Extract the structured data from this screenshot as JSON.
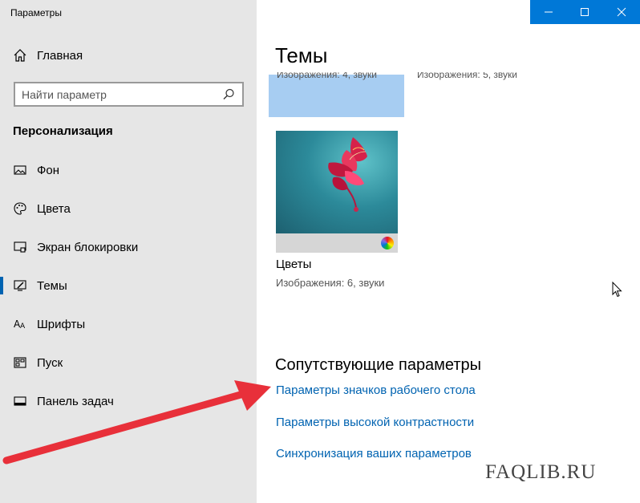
{
  "window": {
    "title": "Параметры"
  },
  "sidebar": {
    "home_label": "Главная",
    "search_placeholder": "Найти параметр",
    "section_heading": "Персонализация",
    "items": [
      {
        "label": "Фон",
        "icon": "image-icon",
        "active": false
      },
      {
        "label": "Цвета",
        "icon": "palette-icon",
        "active": false
      },
      {
        "label": "Экран блокировки",
        "icon": "lock-screen-icon",
        "active": false
      },
      {
        "label": "Темы",
        "icon": "themes-icon",
        "active": true
      },
      {
        "label": "Шрифты",
        "icon": "fonts-icon",
        "active": false
      },
      {
        "label": "Пуск",
        "icon": "start-icon",
        "active": false
      },
      {
        "label": "Панель задач",
        "icon": "taskbar-icon",
        "active": false
      }
    ]
  },
  "main": {
    "title": "Темы",
    "prev_theme_caption": "Изображения: 4, звуки",
    "prev_theme_caption2": "Изображения: 5, звуки",
    "theme": {
      "name": "Цветы",
      "meta": "Изображения: 6, звуки"
    },
    "related": {
      "heading": "Сопутствующие параметры",
      "links": [
        "Параметры значков рабочего стола",
        "Параметры высокой контрастности",
        "Синхронизация ваших параметров"
      ]
    }
  },
  "watermark": "FAQLIB.RU",
  "colors": {
    "accent": "#0063b1",
    "titlebar_controls": "#0078d7",
    "arrow": "#e8303a"
  }
}
